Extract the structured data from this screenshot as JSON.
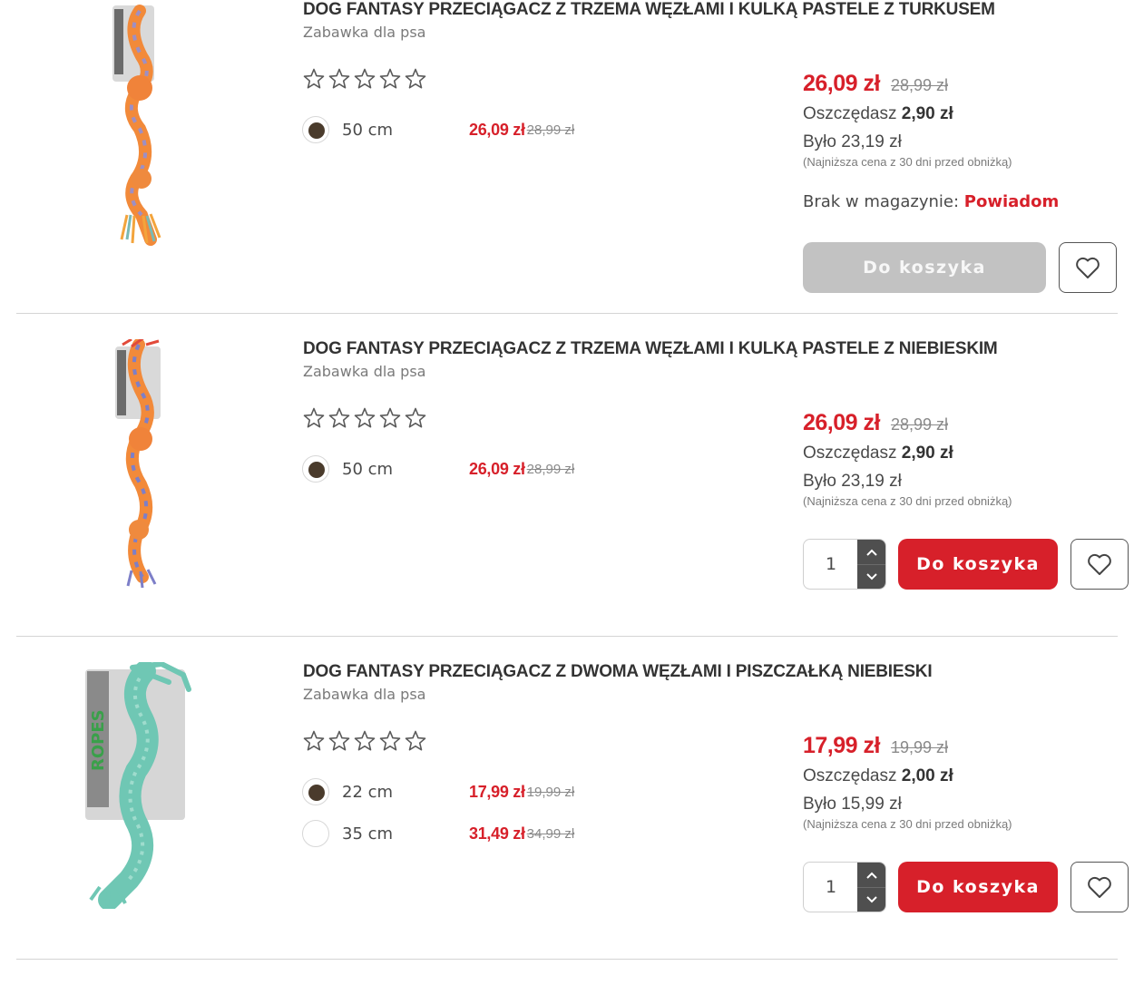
{
  "products": [
    {
      "title": "DOG FANTASY PRZECIĄGACZ Z TRZEMA WĘZŁAMI I KULKĄ PASTELE Z TURKUSEM",
      "subtitle": "Zabawka dla psa",
      "variants": [
        {
          "label": "50 cm",
          "price": "26,09 zł",
          "old_price": "28,99 zł",
          "selected": true
        }
      ],
      "price": "26,09 zł",
      "old_price": "28,99 zł",
      "save_label": "Oszczędasz",
      "save_value": "2,90 zł",
      "was": "Było 23,19 zł",
      "lowest_note": "(Najniższa cena z 30 dni przed obniżką)",
      "stock_label": "Brak w magazynie:",
      "notify_label": "Powiadom",
      "cart_label": "Do koszyka",
      "cart_enabled": false
    },
    {
      "title": "DOG FANTASY PRZECIĄGACZ Z TRZEMA WĘZŁAMI I KULKĄ PASTELE Z NIEBIESKIM",
      "subtitle": "Zabawka dla psa",
      "variants": [
        {
          "label": "50 cm",
          "price": "26,09 zł",
          "old_price": "28,99 zł",
          "selected": true
        }
      ],
      "price": "26,09 zł",
      "old_price": "28,99 zł",
      "save_label": "Oszczędasz",
      "save_value": "2,90 zł",
      "was": "Było 23,19 zł",
      "lowest_note": "(Najniższa cena z 30 dni przed obniżką)",
      "quantity": "1",
      "cart_label": "Do koszyka",
      "cart_enabled": true
    },
    {
      "title": "DOG FANTASY PRZECIĄGACZ Z DWOMA WĘZŁAMI I PISZCZAŁKĄ NIEBIESKI",
      "subtitle": "Zabawka dla psa",
      "variants": [
        {
          "label": "22 cm",
          "price": "17,99 zł",
          "old_price": "19,99 zł",
          "selected": true
        },
        {
          "label": "35 cm",
          "price": "31,49 zł",
          "old_price": "34,99 zł",
          "selected": false
        }
      ],
      "price": "17,99 zł",
      "old_price": "19,99 zł",
      "save_label": "Oszczędasz",
      "save_value": "2,00 zł",
      "was": "Było 15,99 zł",
      "lowest_note": "(Najniższa cena z 30 dni przed obniżką)",
      "quantity": "1",
      "cart_label": "Do koszyka",
      "cart_enabled": true
    }
  ],
  "icons": {
    "rating": "star-outline-icon",
    "wishlist": "heart-outline-icon",
    "qty_up": "chevron-up-icon",
    "qty_down": "chevron-down-icon"
  },
  "colors": {
    "accent": "#d7202a",
    "disabled_button": "#c2c2c2",
    "radio_selected": "#4a3b2c"
  }
}
